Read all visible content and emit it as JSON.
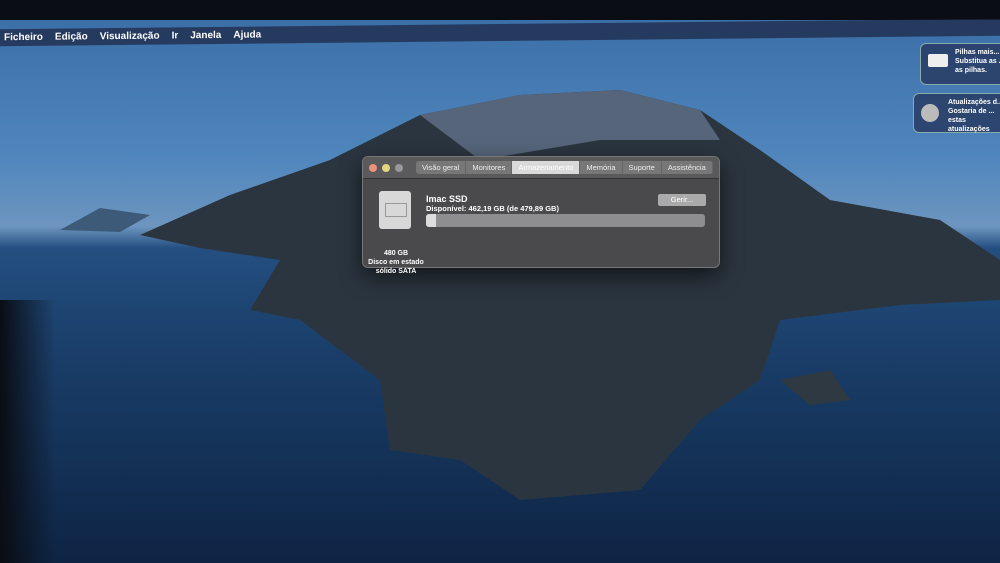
{
  "menubar": [
    "Ficheiro",
    "Edição",
    "Visualização",
    "Ir",
    "Janela",
    "Ajuda"
  ],
  "window": {
    "tabs": [
      "Visão geral",
      "Monitores",
      "Armazenamento",
      "Memória",
      "Suporte",
      "Assistência"
    ],
    "selected_tab": "Armazenamento",
    "disk_name": "Imac SSD",
    "available": "Disponível: 462,19 GB (de 479,89 GB)",
    "used_fraction": 0.037,
    "manage_button": "Gerir...",
    "disk_size": "480 GB",
    "disk_type_1": "Disco em estado",
    "disk_type_2": "sólido SATA"
  },
  "notifications": [
    {
      "title": "Pilhas mais...",
      "l1": "Substitua as ...",
      "l2": "as pilhas."
    },
    {
      "title": "Atualizações d...",
      "l1": "Gostaria de ...",
      "l2": "estas atualizações"
    }
  ]
}
